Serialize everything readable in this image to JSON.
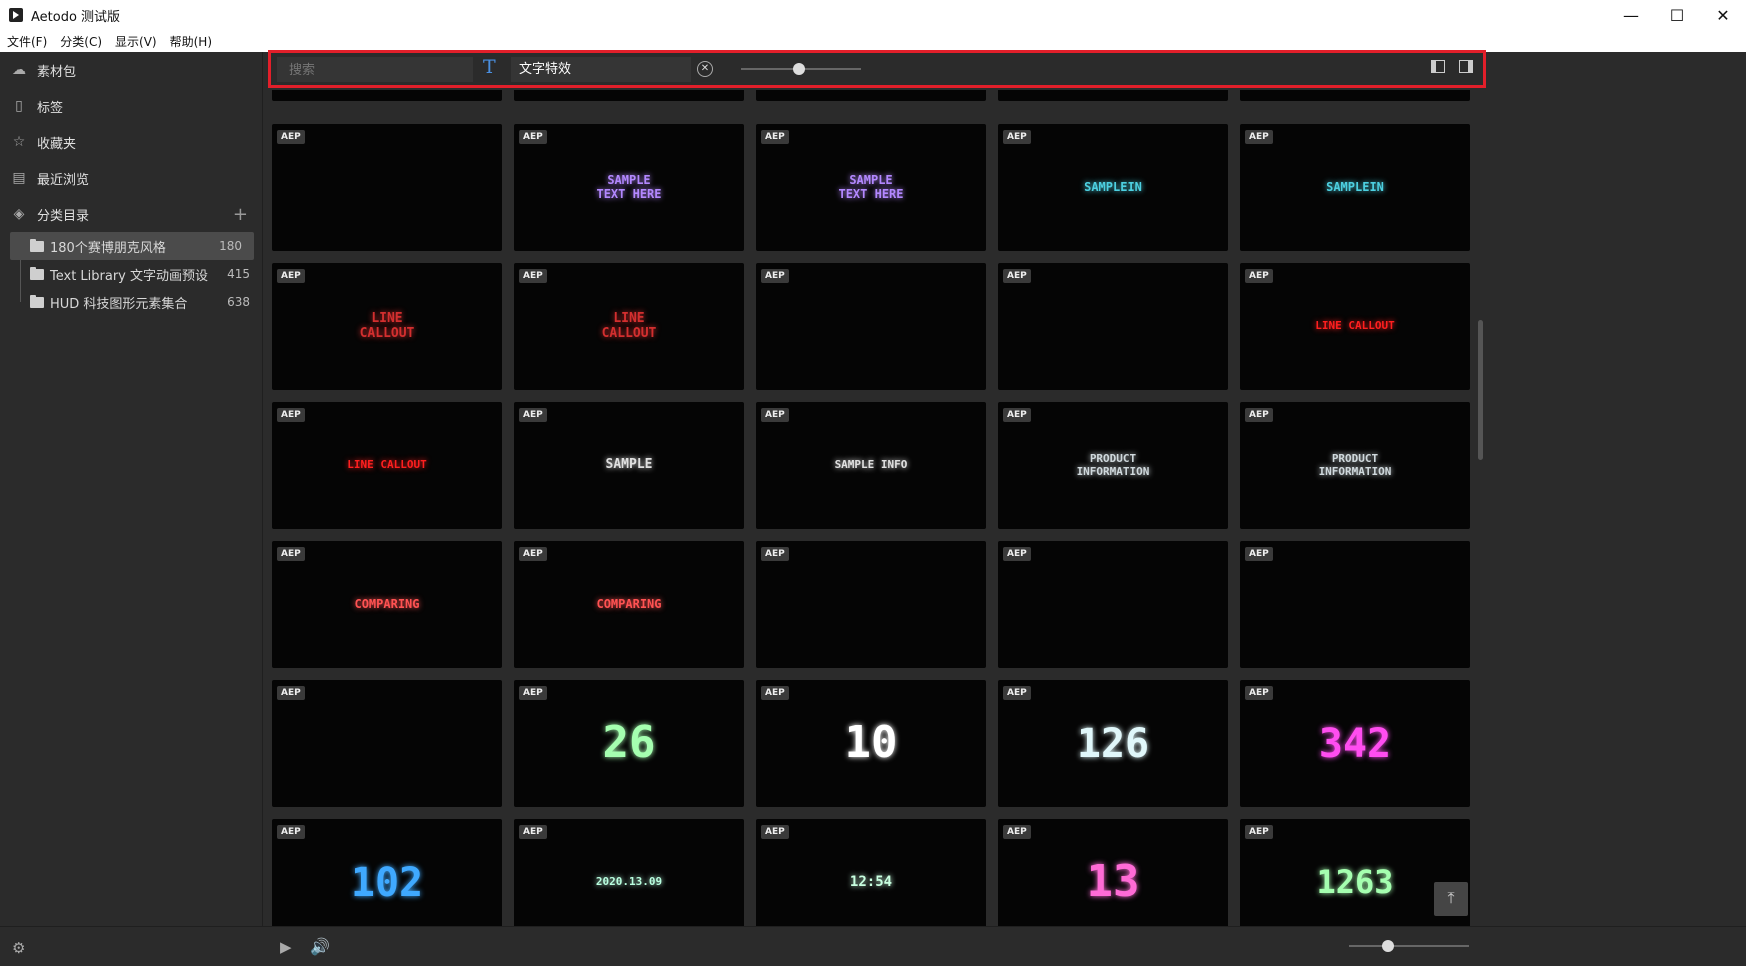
{
  "window": {
    "title": "Aetodo 测试版",
    "min": "—",
    "max": "☐",
    "close": "✕"
  },
  "menu": [
    "文件(F)",
    "分类(C)",
    "显示(V)",
    "帮助(H)"
  ],
  "sidebar": {
    "items": [
      {
        "label": "素材包",
        "icon": "cloud-icon"
      },
      {
        "label": "标签",
        "icon": "tag-icon"
      },
      {
        "label": "收藏夹",
        "icon": "star-icon"
      },
      {
        "label": "最近浏览",
        "icon": "history-icon"
      },
      {
        "label": "分类目录",
        "icon": "layers-icon"
      }
    ],
    "folders": [
      {
        "label": "180个赛博朋克风格",
        "count": "180"
      },
      {
        "label": "Text Library 文字动画预设",
        "count": "415"
      },
      {
        "label": "HUD 科技图形元素集合",
        "count": "638"
      }
    ]
  },
  "toolbar": {
    "search_placeholder": "搜索",
    "filter_text": "文字特效",
    "t_icon": "T"
  },
  "badge": "AEP",
  "cards": [
    {
      "art": "",
      "color": "#ffffff"
    },
    {
      "art": "SAMPLE\nTEXT HERE",
      "color": "#b388ff"
    },
    {
      "art": "SAMPLE\nTEXT HERE",
      "color": "#b388ff"
    },
    {
      "art": "SAMPLEIN",
      "color": "#4dd0e1"
    },
    {
      "art": "SAMPLEIN",
      "color": "#4dd0e1"
    },
    {
      "art": "LINE\nCALLOUT",
      "color": "#d32f2f"
    },
    {
      "art": "LINE\nCALLOUT",
      "color": "#d32f2f"
    },
    {
      "art": "",
      "color": "#d4d400"
    },
    {
      "art": "",
      "color": "#d4d400"
    },
    {
      "art": "LINE CALLOUT",
      "color": "#ff1f1f"
    },
    {
      "art": "LINE CALLOUT",
      "color": "#ff1f1f"
    },
    {
      "art": "SAMPLE",
      "color": "#e0e0e0"
    },
    {
      "art": "SAMPLE INFO",
      "color": "#e0e0e0"
    },
    {
      "art": "PRODUCT\nINFORMATION",
      "color": "#cfd8dc"
    },
    {
      "art": "PRODUCT\nINFORMATION",
      "color": "#cfd8dc"
    },
    {
      "art": "COMPARING",
      "color": "#ff5252"
    },
    {
      "art": "COMPARING",
      "color": "#ff5252"
    },
    {
      "art": "",
      "color": "#66bb6a"
    },
    {
      "art": "",
      "color": "#66bb6a"
    },
    {
      "art": "",
      "color": "#29b6f6"
    },
    {
      "art": "",
      "color": "#29b6f6"
    },
    {
      "art": "26",
      "color": "#a5ffb0"
    },
    {
      "art": "10",
      "color": "#ffffff"
    },
    {
      "art": "126",
      "color": "#e0f7fa"
    },
    {
      "art": "342",
      "color": "#ff4df0"
    },
    {
      "art": "102",
      "color": "#3fa9ff"
    },
    {
      "art": "2020.13.09",
      "color": "#b9ffe0"
    },
    {
      "art": "12:54",
      "color": "#c8ffe0"
    },
    {
      "art": "13",
      "color": "#ff6bd6"
    },
    {
      "art": "1263",
      "color": "#a5ffb0"
    }
  ],
  "bottom": {
    "gear": "⚙",
    "play": "▶",
    "volume": "🔊",
    "totop": "⤒"
  }
}
